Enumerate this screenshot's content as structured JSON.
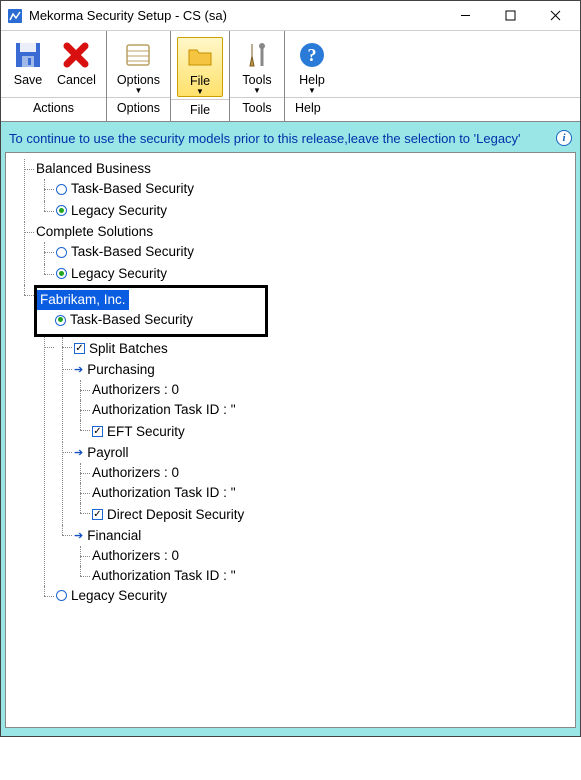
{
  "window": {
    "title": "Mekorma Security Setup  -  CS (sa)"
  },
  "ribbon": {
    "save": "Save",
    "cancel": "Cancel",
    "options": "Options",
    "file": "File",
    "tools": "Tools",
    "help": "Help",
    "group_actions": "Actions",
    "group_options": "Options",
    "group_file": "File",
    "group_tools": "Tools",
    "group_help": "Help"
  },
  "info": "To continue to use the security models prior to this release,leave the selection to 'Legacy'",
  "tree": {
    "c1": "Balanced Business",
    "c1_task": "Task-Based Security",
    "c1_legacy": "Legacy Security",
    "c2": "Complete Solutions",
    "c2_task": "Task-Based Security",
    "c2_legacy": "Legacy Security",
    "c3": "Fabrikam, Inc.",
    "c3_task": "Task-Based Security",
    "split": "Split Batches",
    "purchasing": "Purchasing",
    "p_auth": "Authorizers : 0",
    "p_task": "Authorization Task ID : ''",
    "eft": "EFT Security",
    "payroll": "Payroll",
    "pay_auth": "Authorizers : 0",
    "pay_task": "Authorization Task ID : ''",
    "dd": "Direct Deposit Security",
    "financial": "Financial",
    "fin_auth": "Authorizers : 0",
    "fin_task": "Authorization Task ID : ''",
    "c3_legacy": "Legacy Security"
  }
}
